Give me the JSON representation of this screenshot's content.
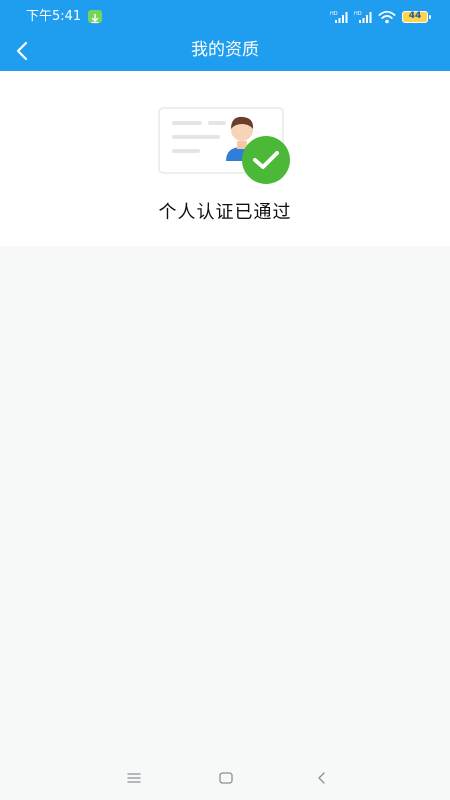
{
  "status_bar": {
    "time": "下午5:41",
    "battery": "44"
  },
  "header": {
    "title": "我的资质",
    "color": "#1f9ef0"
  },
  "verification": {
    "status_text": "个人认证已通过",
    "check_color": "#4cb837"
  },
  "icons": {
    "back": "chevron-left-icon",
    "nav_menu": "menu-icon",
    "nav_home": "square-icon",
    "nav_back": "back-triangle-icon"
  }
}
